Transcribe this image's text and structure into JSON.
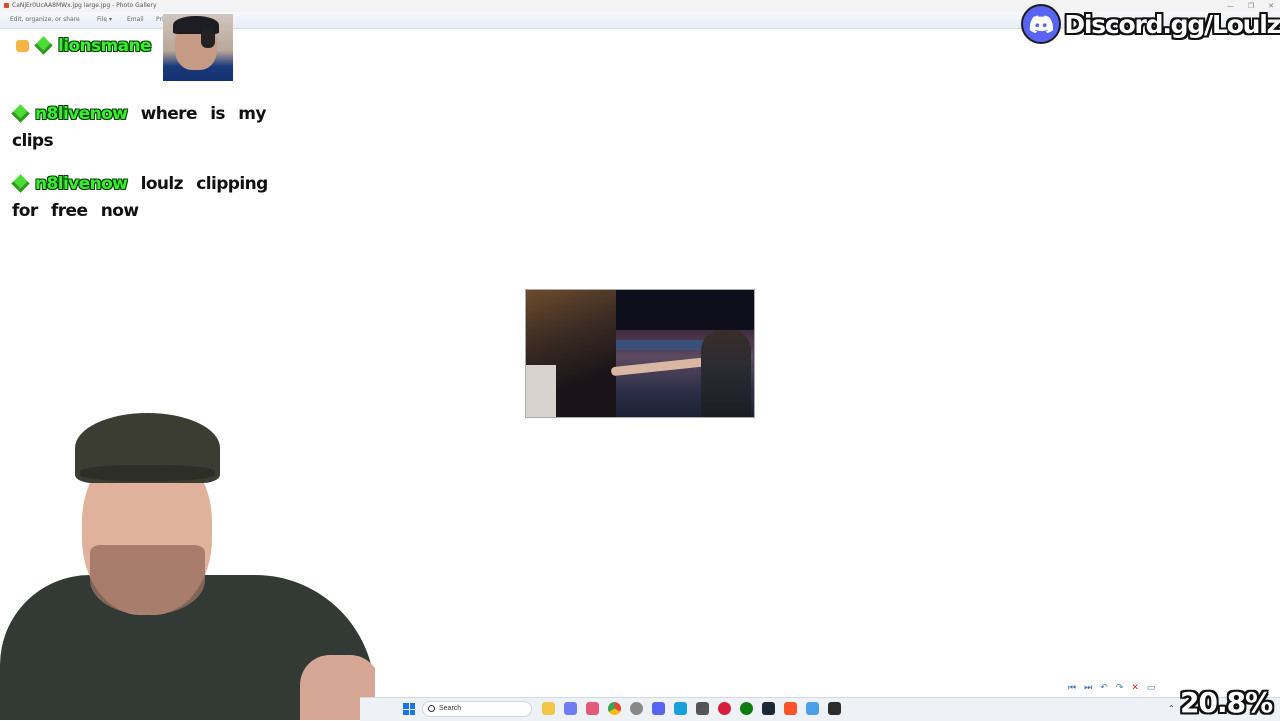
{
  "window": {
    "title": "CaNjEr0UcAA8MWx.jpg large.jpg - Photo Gallery",
    "controls": [
      "—",
      "❐",
      "✕"
    ]
  },
  "menubar": {
    "items": [
      "Edit, organize, or share",
      "File ▾",
      "Email",
      "Print ▾"
    ]
  },
  "chat": {
    "messages": [
      {
        "user": "lionsmane",
        "text": ""
      },
      {
        "user": "n8livenow",
        "text_line1": "where is my",
        "text_line2": "clips"
      },
      {
        "user": "n8livenow",
        "text_line1": "loulz clipping",
        "text_line2": "for free now"
      }
    ]
  },
  "overlay": {
    "discord": "Discord.gg/Loulz",
    "percent": "20.8%"
  },
  "taskbar": {
    "search_placeholder": "Search",
    "apps": [
      "file-explorer",
      "chrome",
      "discord",
      "edge",
      "obs",
      "xbox",
      "steam",
      "brave",
      "notepad",
      "terminal"
    ]
  },
  "colors": {
    "username": "#38ee2e",
    "discord_blue": "#5865f2"
  }
}
